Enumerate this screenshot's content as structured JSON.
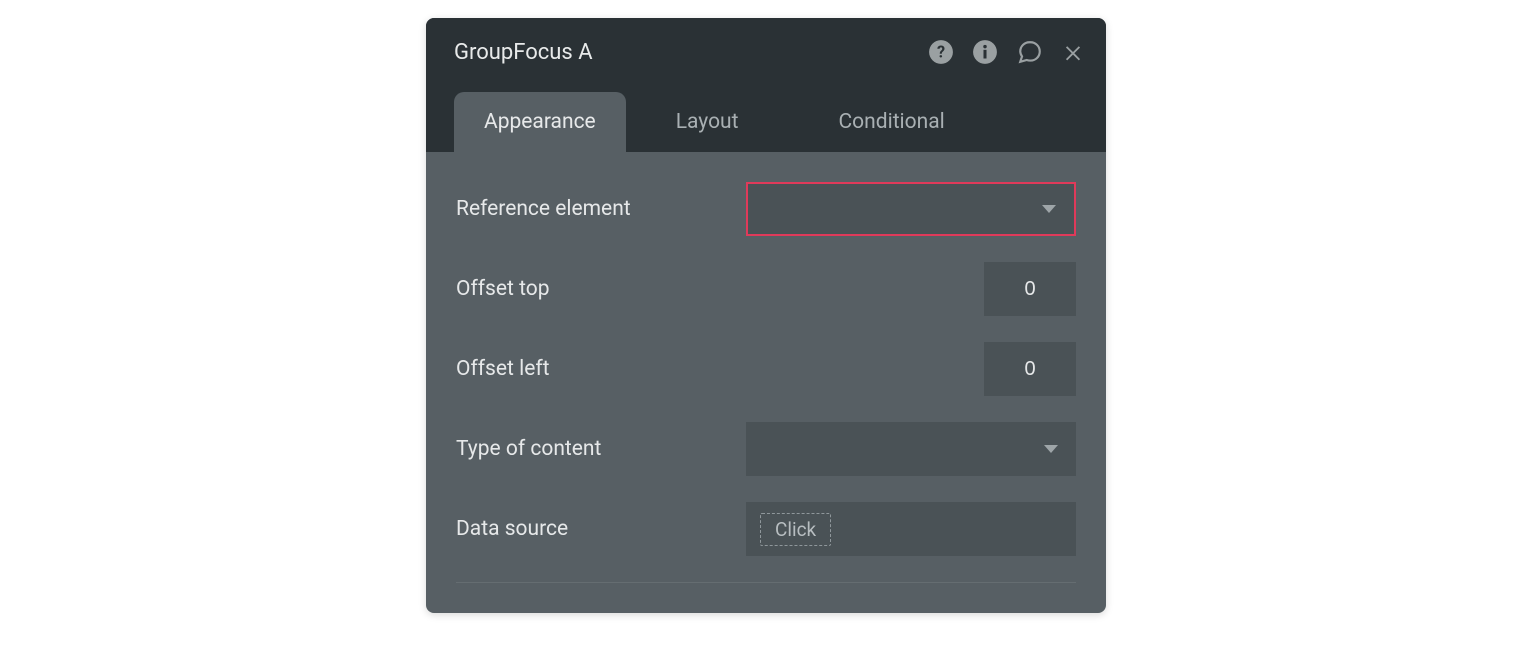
{
  "panel": {
    "title": "GroupFocus A"
  },
  "tabs": {
    "appearance": "Appearance",
    "layout": "Layout",
    "conditional": "Conditional"
  },
  "form": {
    "reference_element_label": "Reference element",
    "offset_top_label": "Offset top",
    "offset_top_value": "0",
    "offset_left_label": "Offset left",
    "offset_left_value": "0",
    "type_of_content_label": "Type of content",
    "data_source_label": "Data source",
    "data_source_chip": "Click"
  }
}
